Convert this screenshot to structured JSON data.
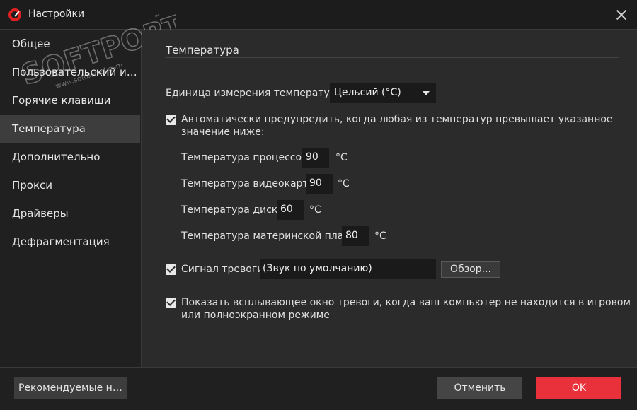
{
  "window": {
    "title": "Настройки"
  },
  "sidebar": {
    "items": [
      {
        "label": "Общее"
      },
      {
        "label": "Пользовательский интерфейс"
      },
      {
        "label": "Горячие клавиши"
      },
      {
        "label": "Температура"
      },
      {
        "label": "Дополнительно"
      },
      {
        "label": "Прокси"
      },
      {
        "label": "Драйверы"
      },
      {
        "label": "Дефрагментация"
      }
    ],
    "active_index": 3
  },
  "watermark": {
    "brand": "SOFTPORTAL",
    "tm": "™",
    "site": "www.softportal.com"
  },
  "content": {
    "section_title": "Температура",
    "unit_label": "Единица измерения температуры:",
    "unit_value": "Цельсий (°C)",
    "auto_warn": {
      "checked": true,
      "line1": "Автоматически предупредить, когда любая из температур превышает указанное",
      "line2": "значение ниже:"
    },
    "thresholds": [
      {
        "label": "Температура процессора:",
        "value": "90",
        "unit": "°C"
      },
      {
        "label": "Температура видеокарты:",
        "value": "90",
        "unit": "°C"
      },
      {
        "label": "Температура диска:",
        "value": "60",
        "unit": "°C"
      },
      {
        "label": "Температура материнской платы:",
        "value": "80",
        "unit": "°C"
      }
    ],
    "alarm": {
      "checked": true,
      "label": "Сигнал тревоги:",
      "value": "(Звук по умолчанию)",
      "browse_label": "Обзор..."
    },
    "popup": {
      "checked": true,
      "line1": "Показать всплывающее окно тревоги, когда ваш компьютер не находится в игровом",
      "line2": "или полноэкранном режиме"
    }
  },
  "footer": {
    "recommend_label": "Рекомендуемые настройки",
    "cancel_label": "Отменить",
    "ok_label": "OK"
  },
  "colors": {
    "accent": "#e8313a",
    "background": "#2b2b2b",
    "sidebar": "#202020"
  }
}
